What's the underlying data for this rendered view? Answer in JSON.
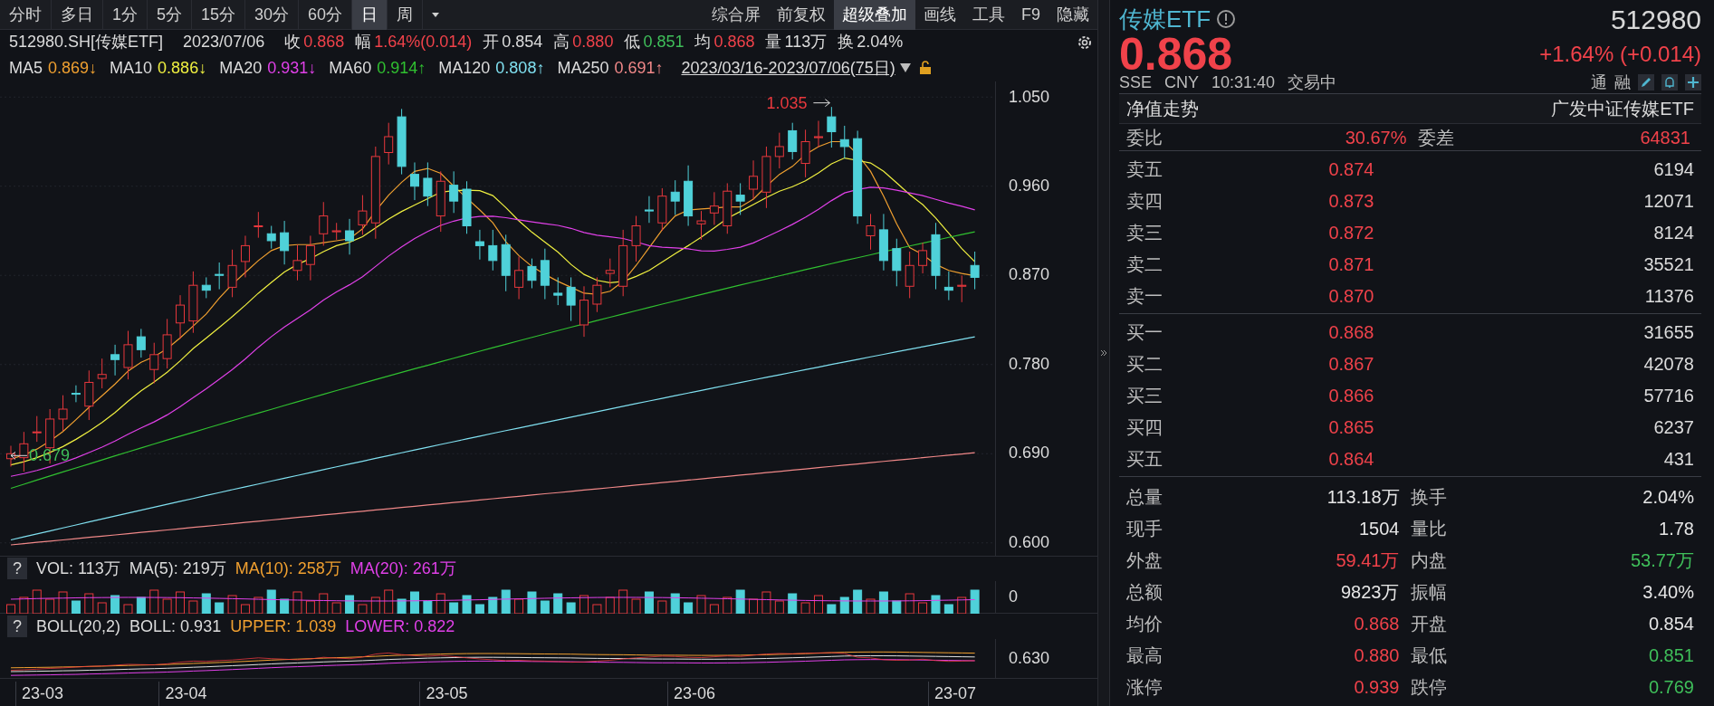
{
  "toolbar": {
    "periods": [
      {
        "label": "分时",
        "selected": false
      },
      {
        "label": "多日",
        "selected": false
      },
      {
        "label": "1分",
        "selected": false
      },
      {
        "label": "5分",
        "selected": false
      },
      {
        "label": "15分",
        "selected": false
      },
      {
        "label": "30分",
        "selected": false
      },
      {
        "label": "60分",
        "selected": false
      },
      {
        "label": "日",
        "selected": true
      },
      {
        "label": "周",
        "selected": false
      }
    ],
    "tools": [
      {
        "label": "综合屏",
        "active": false
      },
      {
        "label": "前复权",
        "active": false
      },
      {
        "label": "超级叠加",
        "active": true
      },
      {
        "label": "画线",
        "active": false
      },
      {
        "label": "工具",
        "active": false
      },
      {
        "label": "F9",
        "active": false
      },
      {
        "label": "隐藏",
        "active": false
      }
    ]
  },
  "quote_line": {
    "code": "512980.SH[传媒ETF]",
    "date": "2023/07/06",
    "fields": [
      {
        "label": "收",
        "value": "0.868",
        "color": "#f0424a"
      },
      {
        "label": "幅",
        "value": "1.64%(0.014)",
        "color": "#f0424a"
      },
      {
        "label": "开",
        "value": "0.854",
        "color": "#dcdcdc"
      },
      {
        "label": "高",
        "value": "0.880",
        "color": "#f0424a"
      },
      {
        "label": "低",
        "value": "0.851",
        "color": "#3fbf5a"
      },
      {
        "label": "均",
        "value": "0.868",
        "color": "#f0424a"
      },
      {
        "label": "量",
        "value": "113万",
        "color": "#dcdcdc"
      },
      {
        "label": "换",
        "value": "2.04%",
        "color": "#dcdcdc"
      }
    ]
  },
  "ma_line": {
    "items": [
      {
        "name": "MA5",
        "value": "0.869↓",
        "color": "#f0a030"
      },
      {
        "name": "MA10",
        "value": "0.886↓",
        "color": "#f0f040"
      },
      {
        "name": "MA20",
        "value": "0.931↓",
        "color": "#e040e8"
      },
      {
        "name": "MA60",
        "value": "0.914↑",
        "color": "#30c030"
      },
      {
        "name": "MA120",
        "value": "0.808↑",
        "color": "#80e0f0"
      },
      {
        "name": "MA250",
        "value": "0.691↑",
        "color": "#f08888"
      }
    ],
    "range": "2023/03/16-2023/07/06(75日)"
  },
  "chart": {
    "y_ticks": [
      "1.050",
      "0.960",
      "0.870",
      "0.780",
      "0.690",
      "0.600"
    ],
    "high_marker": "1.035",
    "low_marker": "0.679"
  },
  "volume_panel": {
    "help": "?",
    "labels": [
      {
        "text": "VOL: 113万",
        "color": "#dcdcdc"
      },
      {
        "text": "MA(5): 219万",
        "color": "#dcdcdc"
      },
      {
        "text": "MA(10): 258万",
        "color": "#f0a030"
      },
      {
        "text": "MA(20): 261万",
        "color": "#e040e8"
      }
    ],
    "axis_label": "0"
  },
  "boll_panel": {
    "help": "?",
    "labels": [
      {
        "text": "BOLL(20,2)",
        "color": "#dcdcdc"
      },
      {
        "text": "BOLL: 0.931",
        "color": "#dcdcdc"
      },
      {
        "text": "UPPER: 1.039",
        "color": "#f0a030"
      },
      {
        "text": "LOWER: 0.822",
        "color": "#e040e8"
      }
    ],
    "axis_label": "0.630"
  },
  "x_axis": [
    "23-03",
    "23-04",
    "23-05",
    "23-06",
    "23-07"
  ],
  "side_panel": {
    "name": "传媒ETF",
    "code": "512980",
    "price": "0.868",
    "change": "+1.64% (+0.014)",
    "meta": [
      "SSE",
      "CNY",
      "10:31:40",
      "交易中"
    ],
    "badges": [
      "通",
      "融"
    ],
    "nav_row": {
      "left": "净值走势",
      "right": "广发中证传媒ETF"
    },
    "ratio_row": [
      {
        "label": "委比",
        "value": "30.67%",
        "color": "#f0424a"
      },
      {
        "label": "委差",
        "value": "64831",
        "color": "#f0424a"
      }
    ],
    "asks": [
      {
        "label": "卖五",
        "price": "0.874",
        "volume": "6194"
      },
      {
        "label": "卖四",
        "price": "0.873",
        "volume": "12071"
      },
      {
        "label": "卖三",
        "price": "0.872",
        "volume": "8124"
      },
      {
        "label": "卖二",
        "price": "0.871",
        "volume": "35521"
      },
      {
        "label": "卖一",
        "price": "0.870",
        "volume": "11376"
      }
    ],
    "bids": [
      {
        "label": "买一",
        "price": "0.868",
        "volume": "31655"
      },
      {
        "label": "买二",
        "price": "0.867",
        "volume": "42078"
      },
      {
        "label": "买三",
        "price": "0.866",
        "volume": "57716"
      },
      {
        "label": "买四",
        "price": "0.865",
        "volume": "6237"
      },
      {
        "label": "买五",
        "price": "0.864",
        "volume": "431"
      }
    ],
    "stats": [
      [
        {
          "label": "总量",
          "value": "113.18万",
          "color": "#e6e6e6"
        },
        {
          "label": "换手",
          "value": "2.04%",
          "color": "#e6e6e6"
        }
      ],
      [
        {
          "label": "现手",
          "value": "1504",
          "color": "#e6e6e6"
        },
        {
          "label": "量比",
          "value": "1.78",
          "color": "#e6e6e6"
        }
      ],
      [
        {
          "label": "外盘",
          "value": "59.41万",
          "color": "#f0424a"
        },
        {
          "label": "内盘",
          "value": "53.77万",
          "color": "#3fbf5a"
        }
      ],
      [
        {
          "label": "总额",
          "value": "9823万",
          "color": "#e6e6e6"
        },
        {
          "label": "振幅",
          "value": "3.40%",
          "color": "#e6e6e6"
        }
      ],
      [
        {
          "label": "均价",
          "value": "0.868",
          "color": "#f0424a"
        },
        {
          "label": "开盘",
          "value": "0.854",
          "color": "#e6e6e6"
        }
      ],
      [
        {
          "label": "最高",
          "value": "0.880",
          "color": "#f0424a"
        },
        {
          "label": "最低",
          "value": "0.851",
          "color": "#3fbf5a"
        }
      ],
      [
        {
          "label": "涨停",
          "value": "0.939",
          "color": "#f0424a"
        },
        {
          "label": "跌停",
          "value": "0.769",
          "color": "#3fbf5a"
        }
      ]
    ]
  }
}
